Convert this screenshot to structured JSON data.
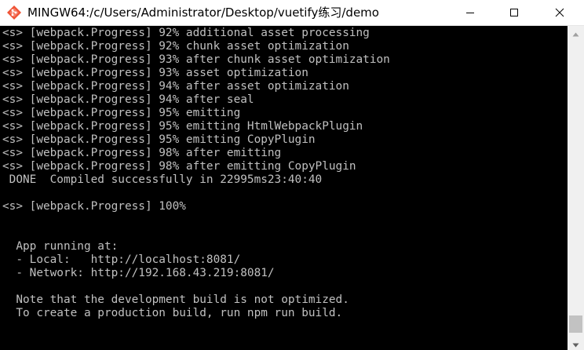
{
  "window": {
    "title": "MINGW64:/c/Users/Administrator/Desktop/vuetify练习/demo"
  },
  "colors": {
    "terminal_bg": "#000000",
    "terminal_text": "#c0c0c0",
    "titlebar_bg": "#ffffff",
    "scrollbar_bg": "#f0f0f0"
  },
  "icons": {
    "app": "git-bash-diamond-icon",
    "minimize": "minimize-icon",
    "maximize": "maximize-icon",
    "close": "close-icon",
    "scroll_up": "scroll-up-arrow-icon",
    "scroll_down": "scroll-down-arrow-icon"
  },
  "terminal": {
    "lines": [
      "<s> [webpack.Progress] 92% additional asset processing",
      "<s> [webpack.Progress] 92% chunk asset optimization",
      "<s> [webpack.Progress] 93% after chunk asset optimization",
      "<s> [webpack.Progress] 93% asset optimization",
      "<s> [webpack.Progress] 94% after asset optimization",
      "<s> [webpack.Progress] 94% after seal",
      "<s> [webpack.Progress] 95% emitting",
      "<s> [webpack.Progress] 95% emitting HtmlWebpackPlugin",
      "<s> [webpack.Progress] 95% emitting CopyPlugin",
      "<s> [webpack.Progress] 98% after emitting",
      "<s> [webpack.Progress] 98% after emitting CopyPlugin",
      " DONE  Compiled successfully in 22995ms23:40:40",
      "",
      "<s> [webpack.Progress] 100%",
      "",
      "",
      "  App running at:",
      "  - Local:   http://localhost:8081/",
      "  - Network: http://192.168.43.219:8081/",
      "",
      "  Note that the development build is not optimized.",
      "  To create a production build, run npm run build.",
      ""
    ]
  }
}
